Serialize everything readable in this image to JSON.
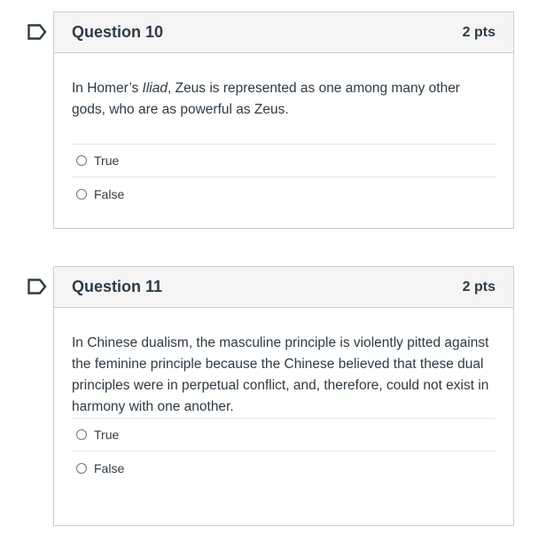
{
  "questions": [
    {
      "title": "Question 10",
      "points": "2 pts",
      "text_before": "In Homer’s ",
      "text_italic": "Iliad",
      "text_after": ", Zeus is represented as one among many other gods, who are as powerful as Zeus.",
      "answers": [
        {
          "label": "True"
        },
        {
          "label": "False"
        }
      ]
    },
    {
      "title": "Question 11",
      "points": "2 pts",
      "text": "In Chinese dualism, the masculine principle is violently pitted against the feminine principle because the Chinese believed that these dual principles were in perpetual conflict, and, therefore, could not exist in harmony with one another.",
      "answers": [
        {
          "label": "True"
        },
        {
          "label": "False"
        }
      ]
    }
  ],
  "icons": {
    "flag": "bookmark-flag-icon"
  },
  "colors": {
    "text": "#2d3b45",
    "border": "#c7cdd1",
    "header_bg": "#f5f5f5"
  }
}
